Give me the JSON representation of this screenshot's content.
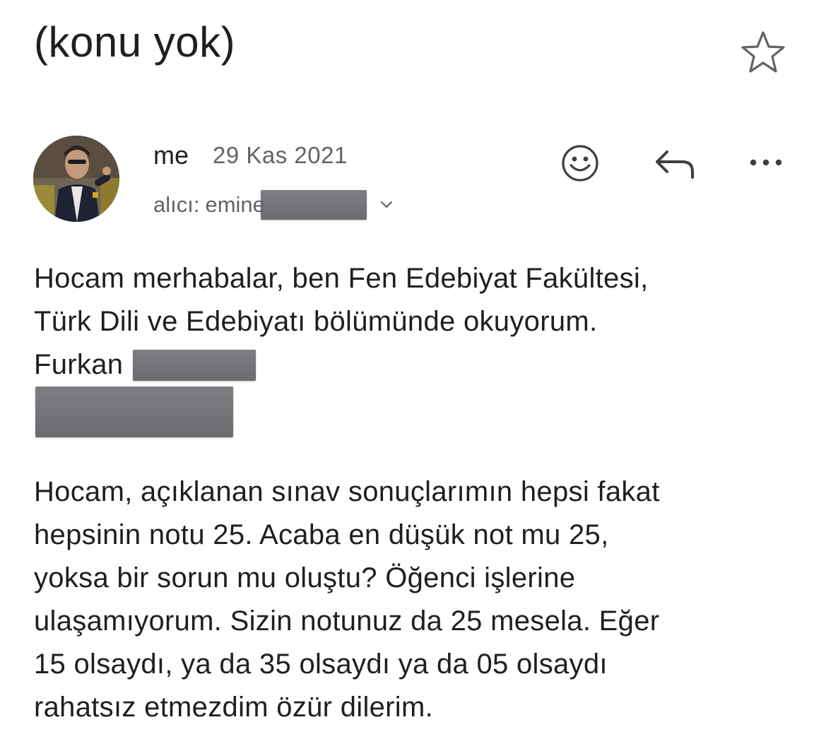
{
  "subject": "(konu yok)",
  "message": {
    "sender": "me",
    "date": "29 Kas 2021",
    "recipient_label": "alıcı:",
    "recipient_visible": "emine"
  },
  "icons": {
    "star": "star-icon",
    "emoji": "emoji-icon",
    "reply": "reply-icon",
    "more": "more-icon",
    "chevron": "chevron-down-icon"
  },
  "body": {
    "paragraph1": [
      "Hocam merhabalar, ben Fen Edebiyat Fakültesi,",
      "Türk Dili ve Edebiyatı bölümünde okuyorum."
    ],
    "signature_name": "Furkan",
    "paragraph2": [
      "Hocam, açıklanan sınav sonuçlarımın hepsi fakat",
      "hepsinin notu 25. Acaba en düşük not mu 25,",
      "yoksa bir sorun mu oluştu? Öğenci işlerine",
      "ulaşamıyorum. Sizin notunuz da 25 mesela. Eğer",
      "15 olsaydı, ya da 35 olsaydı ya da 05 olsaydı",
      "rahatsız etmezdim özür dilerim."
    ]
  },
  "colors": {
    "text": "#1f1f1f",
    "secondary": "#5f6368",
    "redaction": "#747478"
  }
}
